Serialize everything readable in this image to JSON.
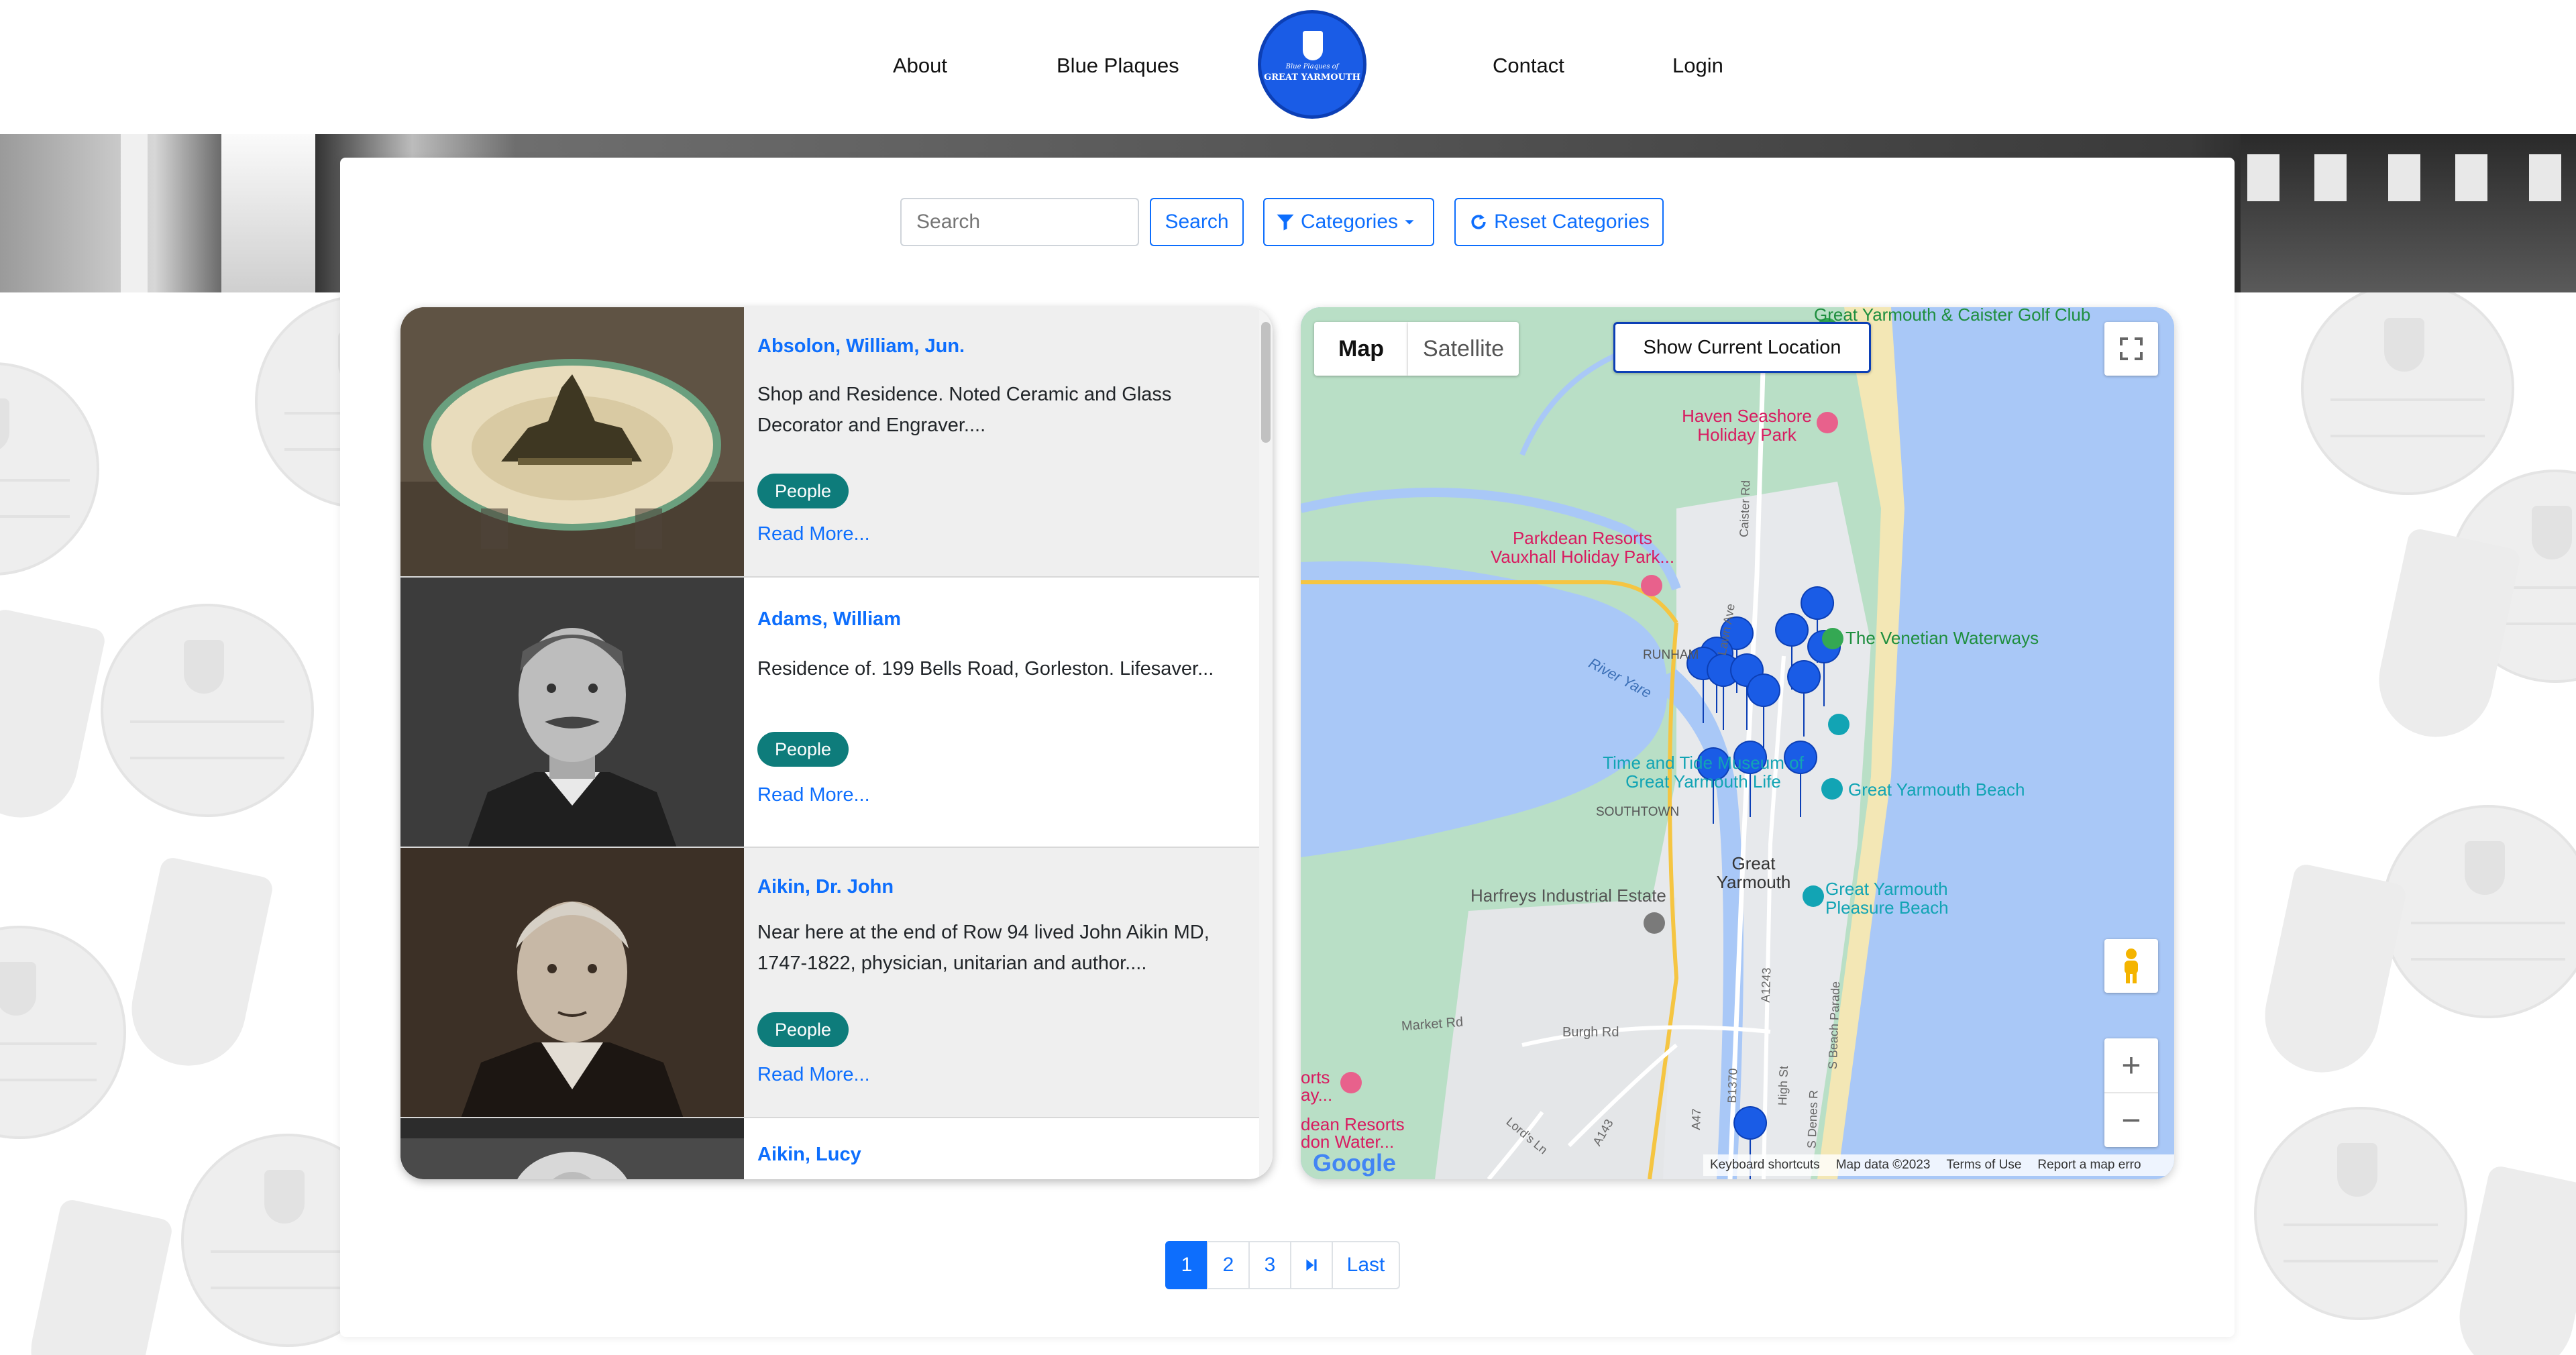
{
  "nav": {
    "items": [
      {
        "label": "About"
      },
      {
        "label": "Blue Plaques"
      },
      {
        "label": "Contact"
      },
      {
        "label": "Login"
      }
    ],
    "logo_text_top": "Blue Plaques of",
    "logo_text": "GREAT YARMOUTH"
  },
  "toolbar": {
    "search_placeholder": "Search",
    "search_button": "Search",
    "categories_button": "Categories",
    "reset_button": "Reset Categories"
  },
  "plaques": [
    {
      "title": "Absolon, William, Jun.",
      "description": "Shop and Residence. Noted Ceramic and Glass Decorator and Engraver....",
      "category": "People",
      "link": "Read More..."
    },
    {
      "title": "Adams, William",
      "description": "Residence of. 199 Bells Road, Gorleston. Lifesaver...",
      "category": "People",
      "link": "Read More..."
    },
    {
      "title": "Aikin, Dr. John",
      "description": "Near here at the end of Row 94 lived John Aikin MD, 1747-1822, physician, unitarian and author....",
      "category": "People",
      "link": "Read More..."
    },
    {
      "title": "Aikin, Lucy",
      "description": "",
      "category": "",
      "link": ""
    }
  ],
  "map": {
    "type_map": "Map",
    "type_satellite": "Satellite",
    "show_location": "Show Current Location",
    "labels": {
      "golf": "Great Yarmouth & Caister Golf Club",
      "haven": "Haven Seashore Holiday Park",
      "parkdean": "Parkdean Resorts Vauxhall Holiday Park...",
      "venetian": "The Venetian Waterways",
      "runham": "RUNHAM",
      "river_yare": "River Yare",
      "time_tide": "Time and Tide Museum of Great Yarmouth Life",
      "southtown": "SOUTHTOWN",
      "gy_beach": "Great Yarmouth Beach",
      "great_yarmouth": "Great Yarmouth",
      "pleasure_beach": "Great Yarmouth Pleasure Beach",
      "harfreys": "Harfreys Industrial Estate",
      "market_rd": "Market Rd",
      "burgh_rd": "Burgh Rd",
      "caister_rd": "Caister Rd",
      "lawn_ave": "Lawn Ave",
      "a1243": "A1243",
      "s_beach_parade": "S Beach Parade",
      "b1370": "B1370",
      "a47": "A47",
      "a143": "A143",
      "lords_ln": "Lord's Ln",
      "sports_way": "orts ay...",
      "parkdean_bottom": "dean Resorts don Water...",
      "s_denes": "S Denes R",
      "high_st": "High St"
    },
    "footer": {
      "keyboard": "Keyboard shortcuts",
      "map_data": "Map data ©2023",
      "terms": "Terms of Use",
      "report": "Report a map erro"
    },
    "google": "Google"
  },
  "pagination": {
    "pages": [
      "1",
      "2",
      "3"
    ],
    "last": "Last",
    "current": "1"
  }
}
